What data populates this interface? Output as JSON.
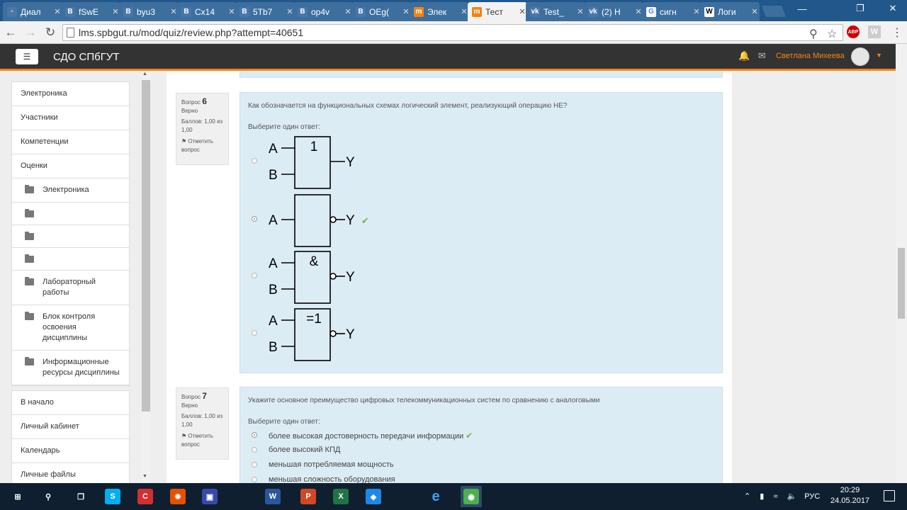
{
  "browser": {
    "tabs": [
      {
        "label": "Диал",
        "icon": "chat-icon",
        "color": "#4a76a8"
      },
      {
        "label": "fSwE",
        "icon": "vk-b-icon",
        "color": "#4a76a8"
      },
      {
        "label": "byu3",
        "icon": "vk-b-icon",
        "color": "#4a76a8"
      },
      {
        "label": "Cx14",
        "icon": "vk-b-icon",
        "color": "#4a76a8"
      },
      {
        "label": "5Tb7",
        "icon": "vk-b-icon",
        "color": "#4a76a8"
      },
      {
        "label": "op4v",
        "icon": "vk-b-icon",
        "color": "#4a76a8"
      },
      {
        "label": "OEg(",
        "icon": "vk-b-icon",
        "color": "#4a76a8"
      },
      {
        "label": "Элек",
        "icon": "moodle-icon",
        "color": "#f98012"
      },
      {
        "label": "Тест",
        "icon": "moodle-icon",
        "color": "#f98012"
      },
      {
        "label": "Test_",
        "icon": "vk-icon",
        "color": "#4a76a8"
      },
      {
        "label": "(2) Н",
        "icon": "vk-icon",
        "color": "#4a76a8"
      },
      {
        "label": "сигн",
        "icon": "google-icon",
        "color": "#4285f4"
      },
      {
        "label": "Логи",
        "icon": "wikipedia-icon",
        "color": "#ffffff"
      }
    ],
    "url": "lms.spbgut.ru/mod/quiz/review.php?attempt=40651"
  },
  "header": {
    "brand": "СДО СПбГУТ",
    "user_name": "Светлана Михеева"
  },
  "sidebar": {
    "items": [
      {
        "label": "Электроника",
        "sub": false
      },
      {
        "label": "Участники",
        "sub": false
      },
      {
        "label": "Компетенции",
        "sub": false
      },
      {
        "label": "Оценки",
        "sub": false
      },
      {
        "label": "Электроника",
        "sub": true
      },
      {
        "label": "",
        "sub": true
      },
      {
        "label": "",
        "sub": true
      },
      {
        "label": "",
        "sub": true
      },
      {
        "label": "Лабораторный работы",
        "sub": true
      },
      {
        "label": "Блок контроля освоения дисциплины",
        "sub": true
      },
      {
        "label": "Информационные ресурсы дисциплины",
        "sub": true
      }
    ],
    "nav_items": [
      "В начало",
      "Личный кабинет",
      "Календарь",
      "Личные файлы"
    ]
  },
  "questions": [
    {
      "label": "Вопрос",
      "number": "6",
      "state": "Верно",
      "score": "Баллов: 1,00 из 1,00",
      "flag": "Отметить вопрос",
      "text": "Как обозначается на функциональных схемах логический элемент, реализующий операцию НЕ?",
      "prompt": "Выберите один ответ:",
      "options": [
        {
          "symbol": "1",
          "inputs": [
            "A",
            "B"
          ],
          "output": "Y",
          "inverted": false,
          "selected": false
        },
        {
          "symbol": "",
          "inputs": [
            "A"
          ],
          "output": "Y",
          "inverted": true,
          "selected": true,
          "correct": true
        },
        {
          "symbol": "&",
          "inputs": [
            "A",
            "B"
          ],
          "output": "Y",
          "inverted": true,
          "selected": false
        },
        {
          "symbol": "=1",
          "inputs": [
            "A",
            "B"
          ],
          "output": "Y",
          "inverted": true,
          "selected": false
        }
      ]
    },
    {
      "label": "Вопрос",
      "number": "7",
      "state": "Верно",
      "score": "Баллов: 1,00 из 1,00",
      "flag": "Отметить вопрос",
      "text": "Укажите основное преимущество цифровых телекоммуникационных систем по сравнению с аналоговыми",
      "prompt": "Выберите один ответ:",
      "options": [
        {
          "label": "более высокая достоверность передачи информации",
          "selected": true,
          "correct": true
        },
        {
          "label": "более высокий КПД",
          "selected": false
        },
        {
          "label": "меньшая потребляемая мощность",
          "selected": false
        },
        {
          "label": "меньшая сложность оборудования",
          "selected": false
        }
      ]
    }
  ],
  "taskbar": {
    "apps": [
      "windows-icon",
      "search-icon",
      "task-view-icon",
      "skype-icon",
      "app-red-icon",
      "app-orange-icon",
      "app-blue-icon",
      "word-icon",
      "powerpoint-icon",
      "excel-icon",
      "app-cube-icon",
      "edge-icon",
      "chrome-icon"
    ],
    "lang": "РУС",
    "time": "20:29",
    "date": "24.05.2017"
  }
}
